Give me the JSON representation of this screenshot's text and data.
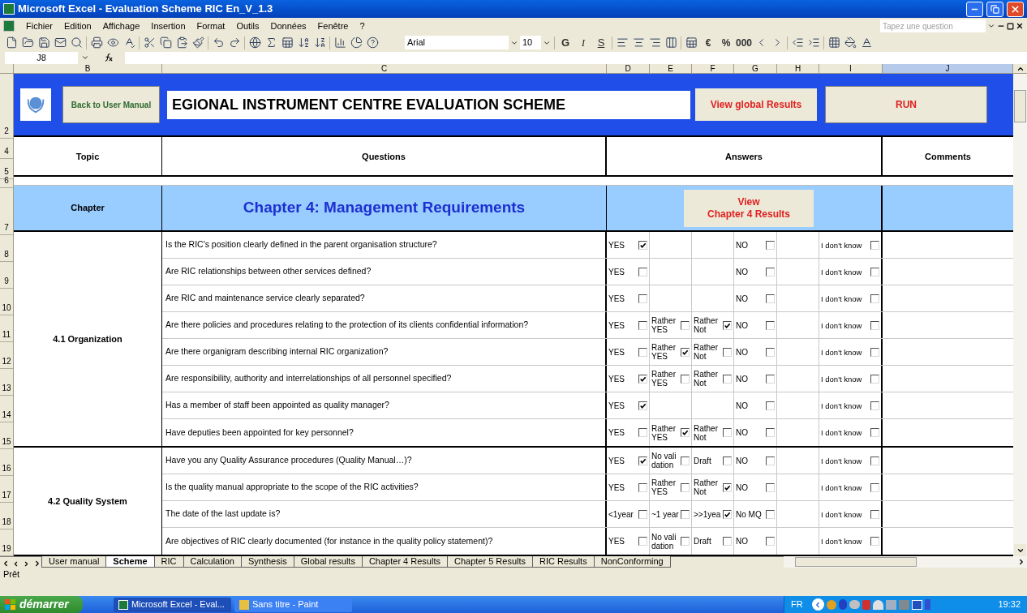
{
  "window": {
    "title": "Microsoft Excel - Evaluation Scheme RIC En_V_1.3"
  },
  "menu": [
    "Fichier",
    "Edition",
    "Affichage",
    "Insertion",
    "Format",
    "Outils",
    "Données",
    "Fenêtre",
    "?"
  ],
  "help_search": {
    "placeholder": "Tapez une question"
  },
  "toolbar": {
    "font": "Arial",
    "size": "10",
    "format_buttons": [
      "G",
      "I",
      "S"
    ],
    "number_buttons": [
      "€",
      "%",
      "000"
    ]
  },
  "formula_bar": {
    "cell": "J8"
  },
  "columns": [
    {
      "label": "B",
      "selected": false
    },
    {
      "label": "C",
      "selected": false
    },
    {
      "label": "D",
      "selected": false
    },
    {
      "label": "E",
      "selected": false
    },
    {
      "label": "F",
      "selected": false
    },
    {
      "label": "G",
      "selected": false
    },
    {
      "label": "H",
      "selected": false
    },
    {
      "label": "I",
      "selected": false
    },
    {
      "label": "J",
      "selected": true
    }
  ],
  "banner": {
    "row_number": "2",
    "back_button": "Back to User Manual",
    "title": "EGIONAL INSTRUMENT CENTRE EVALUATION SCHEME",
    "results_button": "View global Results",
    "run_button": "RUN"
  },
  "headings": {
    "row_numbers": [
      "4",
      "5"
    ],
    "topic": "Topic",
    "questions": "Questions",
    "answers": "Answers",
    "comments": "Comments"
  },
  "spacer_row": {
    "row_number": "6"
  },
  "chapter": {
    "row_number": "7",
    "label": "Chapter",
    "title": "Chapter 4: Management Requirements",
    "results_button": [
      "View",
      "Chapter 4 Results"
    ]
  },
  "sections": [
    {
      "topic": "4.1 Organization",
      "rows": [
        {
          "row_number": "8",
          "question": "Is the RIC's position clearly defined in the parent organisation structure?",
          "options": [
            {
              "kind": "positive",
              "label": "YES",
              "checked": true
            },
            {
              "kind": "negative",
              "label": "NO",
              "checked": false
            },
            {
              "kind": "unknown",
              "label": "I don't know",
              "checked": false
            }
          ]
        },
        {
          "row_number": "9",
          "question": "Are RIC relationships between other services defined?",
          "options": [
            {
              "kind": "positive",
              "label": "YES",
              "checked": false
            },
            {
              "kind": "negative",
              "label": "NO",
              "checked": false
            },
            {
              "kind": "unknown",
              "label": "I don't know",
              "checked": false
            }
          ]
        },
        {
          "row_number": "10",
          "question": "Are RIC and maintenance service clearly separated?",
          "options": [
            {
              "kind": "positive",
              "label": "YES",
              "checked": false
            },
            {
              "kind": "negative",
              "label": "NO",
              "checked": false
            },
            {
              "kind": "unknown",
              "label": "I don't know",
              "checked": false
            }
          ]
        },
        {
          "row_number": "11",
          "question": "Are there policies and procedures relating to the protection of its clients confidential information?",
          "options": [
            {
              "kind": "positive",
              "label": "YES",
              "checked": false
            },
            {
              "kind": "partial_positive",
              "label": "Rather YES",
              "checked": false
            },
            {
              "kind": "partial_negative",
              "label": "Rather Not",
              "checked": true
            },
            {
              "kind": "negative",
              "label": "NO",
              "checked": false
            },
            {
              "kind": "unknown",
              "label": "I don't know",
              "checked": false
            }
          ]
        },
        {
          "row_number": "12",
          "question": "Are there organigram describing internal RIC organization?",
          "options": [
            {
              "kind": "positive",
              "label": "YES",
              "checked": false
            },
            {
              "kind": "partial_positive",
              "label": "Rather YES",
              "checked": true
            },
            {
              "kind": "partial_negative",
              "label": "Rather Not",
              "checked": false
            },
            {
              "kind": "negative",
              "label": "NO",
              "checked": false
            },
            {
              "kind": "unknown",
              "label": "I don't know",
              "checked": false
            }
          ]
        },
        {
          "row_number": "13",
          "question": "Are responsibility, authority and interrelationships of all personnel specified?",
          "options": [
            {
              "kind": "positive",
              "label": "YES",
              "checked": true
            },
            {
              "kind": "partial_positive",
              "label": "Rather YES",
              "checked": false
            },
            {
              "kind": "partial_negative",
              "label": "Rather Not",
              "checked": false
            },
            {
              "kind": "negative",
              "label": "NO",
              "checked": false
            },
            {
              "kind": "unknown",
              "label": "I don't know",
              "checked": false
            }
          ]
        },
        {
          "row_number": "14",
          "question": "Has a member of staff been appointed as quality manager?",
          "options": [
            {
              "kind": "positive",
              "label": "YES",
              "checked": true
            },
            {
              "kind": "negative",
              "label": "NO",
              "checked": false
            },
            {
              "kind": "unknown",
              "label": "I don't know",
              "checked": false
            }
          ]
        },
        {
          "row_number": "15",
          "question": "Have deputies been appointed for key personnel?",
          "options": [
            {
              "kind": "positive",
              "label": "YES",
              "checked": false
            },
            {
              "kind": "partial_positive",
              "label": "Rather YES",
              "checked": true
            },
            {
              "kind": "partial_negative",
              "label": "Rather Not",
              "checked": false
            },
            {
              "kind": "negative",
              "label": "NO",
              "checked": false
            },
            {
              "kind": "unknown",
              "label": "I don't know",
              "checked": false
            }
          ]
        }
      ]
    },
    {
      "topic": "4.2 Quality System",
      "rows": [
        {
          "row_number": "16",
          "question": "Have you any Quality Assurance procedures (Quality Manual…)?",
          "options": [
            {
              "kind": "positive",
              "label": "YES",
              "checked": true
            },
            {
              "kind": "partial_positive",
              "label": "No validation",
              "checked": false
            },
            {
              "kind": "partial_negative",
              "label": "Draft",
              "checked": false
            },
            {
              "kind": "negative",
              "label": "NO",
              "checked": false
            },
            {
              "kind": "unknown",
              "label": "I don't know",
              "checked": false
            }
          ]
        },
        {
          "row_number": "17",
          "question": "Is the quality manual appropriate to the scope of the RIC activities?",
          "options": [
            {
              "kind": "positive",
              "label": "YES",
              "checked": false
            },
            {
              "kind": "partial_positive",
              "label": "Rather YES",
              "checked": false
            },
            {
              "kind": "partial_negative",
              "label": "Rather Not",
              "checked": true
            },
            {
              "kind": "negative",
              "label": "NO",
              "checked": false
            },
            {
              "kind": "unknown",
              "label": "I don't know",
              "checked": false
            }
          ]
        },
        {
          "row_number": "18",
          "question": "The date of the last update is?",
          "options": [
            {
              "kind": "positive",
              "label": "<1year",
              "checked": false
            },
            {
              "kind": "partial_positive",
              "label": "~1 year",
              "checked": false
            },
            {
              "kind": "partial_negative",
              "label": ">>1yea",
              "checked": true
            },
            {
              "kind": "negative",
              "label": "No MQ",
              "checked": false
            },
            {
              "kind": "unknown",
              "label": "I don't know",
              "checked": false
            }
          ]
        },
        {
          "row_number": "19",
          "question": "Are objectives of RIC clearly documented (for instance in the quality policy statement)?",
          "options": [
            {
              "kind": "positive",
              "label": "YES",
              "checked": false
            },
            {
              "kind": "partial_positive",
              "label": "No validation",
              "checked": false
            },
            {
              "kind": "partial_negative",
              "label": "Draft",
              "checked": false
            },
            {
              "kind": "negative",
              "label": "NO",
              "checked": false
            },
            {
              "kind": "unknown",
              "label": "I don't know",
              "checked": false
            }
          ]
        }
      ]
    }
  ],
  "sheet_tabs": [
    {
      "label": "User manual",
      "selected": false
    },
    {
      "label": "Scheme",
      "selected": true
    },
    {
      "label": "RIC",
      "selected": false
    },
    {
      "label": "Calculation",
      "selected": false
    },
    {
      "label": "Synthesis",
      "selected": false
    },
    {
      "label": "Global results",
      "selected": false
    },
    {
      "label": "Chapter 4 Results",
      "selected": false
    },
    {
      "label": "Chapter 5 Results",
      "selected": false
    },
    {
      "label": "RIC Results",
      "selected": false
    },
    {
      "label": "NonConforming",
      "selected": false
    }
  ],
  "status_bar": {
    "text": "Prêt"
  },
  "taskbar": {
    "start": "démarrer",
    "tasks": [
      {
        "label": "Microsoft Excel - Eval...",
        "selected": true
      },
      {
        "label": "Sans titre - Paint",
        "selected": false
      }
    ],
    "language": "FR",
    "clock": "19:32"
  }
}
